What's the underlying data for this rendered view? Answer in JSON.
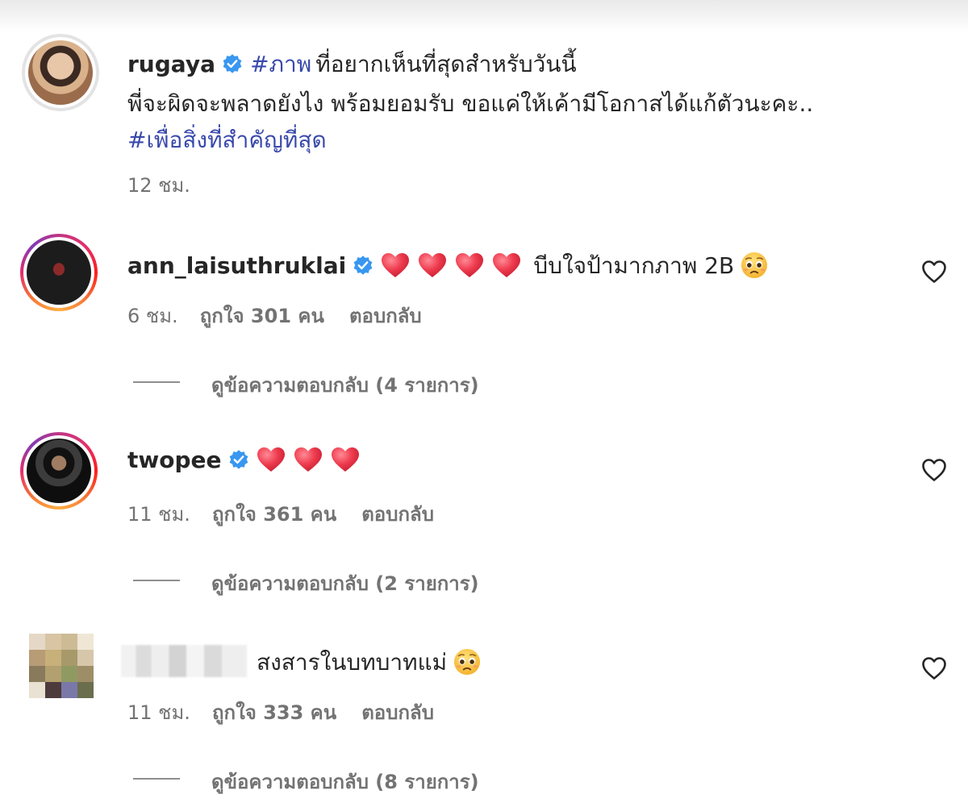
{
  "post": {
    "username": "rugaya",
    "hashtag1": "#ภาพ",
    "line1_text": "ที่อยากเห็นที่สุดสำหรับวันนี้",
    "line2_text": "พี่จะผิดจะพลาดยังไง พร้อมยอมรับ ขอแค่ให้เค้ามีโอกาสได้แก้ตัวนะคะ..",
    "hashtag2": "#เพื่อสิ่งที่สำคัญที่สุด",
    "time": "12 ชม."
  },
  "comments": [
    {
      "username": "ann_laisuthruklai",
      "hearts": 4,
      "text": "บีบใจป้ามากภาพ 2B",
      "time": "6 ชม.",
      "likes": "ถูกใจ 301 คน",
      "reply": "ตอบกลับ",
      "view_replies": "ดูข้อความตอบกลับ (4 รายการ)"
    },
    {
      "username": "twopee",
      "hearts": 3,
      "text": "",
      "time": "11 ชม.",
      "likes": "ถูกใจ 361 คน",
      "reply": "ตอบกลับ",
      "view_replies": "ดูข้อความตอบกลับ (2 รายการ)"
    },
    {
      "username": "",
      "text": "สงสารในบทบาทแม่",
      "time": "11 ชม.",
      "likes": "ถูกใจ 333 คน",
      "reply": "ตอบกลับ",
      "view_replies": "ดูข้อความตอบกลับ (8 รายการ)"
    }
  ],
  "colors": {
    "hashtag": "#3949ab",
    "verified": "#3897f0",
    "heart": "#e8324a",
    "meta": "#737373"
  },
  "icons": [
    "verified-badge-icon",
    "heart-emoji-icon",
    "pleading-face-emoji-icon",
    "heart-outline-icon"
  ]
}
